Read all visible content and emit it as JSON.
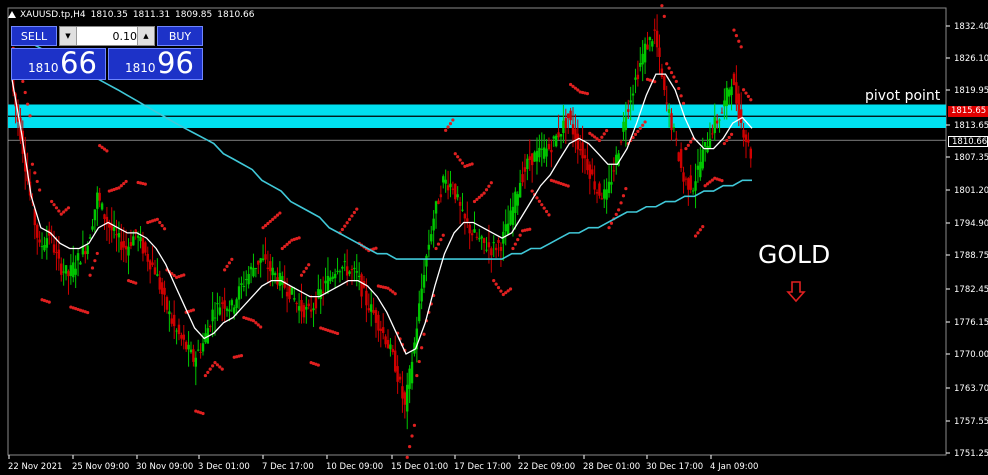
{
  "header": {
    "symbol_info": "XAUUSD.tp,H4",
    "ohlc": [
      "1810.35",
      "1811.31",
      "1809.85",
      "1810.66"
    ],
    "icon": "triangle-up-icon"
  },
  "one_click": {
    "sell_label": "SELL",
    "buy_label": "BUY",
    "lot_value": "0.10",
    "sell_prefix": "1810",
    "sell_pips": "66",
    "buy_prefix": "1810",
    "buy_pips": "96",
    "down_icon": "arrow-down-icon",
    "up_icon": "arrow-up-icon"
  },
  "annotations": {
    "pivot": "pivot point",
    "gold": "GOLD",
    "gold_arrow_icon": "outline-arrow-down-icon",
    "gold_arrow_color": "#e02020"
  },
  "price_tags": {
    "pivot_level": "1815.65",
    "current_bid": "1810.66",
    "pivot_color": "#e00000"
  },
  "colors": {
    "background": "#000000",
    "bull": "#00c800",
    "bear": "#d00000",
    "ma_fast": "#ffffff",
    "ma_slow": "#40c8d8",
    "psar": "#e02020",
    "pivot_band": "#00e0f0"
  },
  "chart_data": {
    "type": "line",
    "instrument": "XAUUSD",
    "timeframe": "H4",
    "y_ticks": [
      "1832.40",
      "1826.10",
      "1819.95",
      "1813.65",
      "1807.35",
      "1801.20",
      "1794.90",
      "1788.75",
      "1782.45",
      "1776.15",
      "1770.00",
      "1763.70",
      "1757.55",
      "1751.25"
    ],
    "x_ticks": [
      "22 Nov 2021",
      "25 Nov 09:00",
      "30 Nov 09:00",
      "3 Dec 01:00",
      "7 Dec 17:00",
      "10 Dec 09:00",
      "15 Dec 01:00",
      "17 Dec 17:00",
      "22 Dec 09:00",
      "28 Dec 01:00",
      "30 Dec 17:00",
      "4 Jan 09:00"
    ],
    "ylim": [
      1749,
      1835
    ],
    "pivot_zone": [
      1813.65,
      1816.8
    ],
    "current_price": 1810.66,
    "series": [
      {
        "kind": "price_path",
        "values": [
          1822,
          1812,
          1800,
          1790,
          1793,
          1787,
          1785,
          1788,
          1791,
          1800,
          1795,
          1792,
          1790,
          1793,
          1789,
          1786,
          1780,
          1775,
          1772,
          1769,
          1772,
          1778,
          1780,
          1779,
          1783,
          1786,
          1788,
          1786,
          1784,
          1782,
          1779,
          1778,
          1781,
          1784,
          1787,
          1786,
          1785,
          1780,
          1777,
          1773,
          1768,
          1760,
          1772,
          1786,
          1796,
          1803,
          1802,
          1796,
          1793,
          1791,
          1790,
          1791,
          1796,
          1803,
          1807,
          1808,
          1809,
          1812,
          1815,
          1810,
          1806,
          1801,
          1800,
          1807,
          1816,
          1822,
          1828,
          1831,
          1819,
          1812,
          1803,
          1802,
          1808,
          1813,
          1816,
          1822,
          1814,
          1808
        ]
      },
      {
        "kind": "moving_average_fast",
        "values": [
          1822,
          1812,
          1800,
          1794,
          1793,
          1791,
          1790,
          1790,
          1791,
          1794,
          1795,
          1794,
          1793,
          1793,
          1792,
          1790,
          1787,
          1783,
          1779,
          1775,
          1773,
          1774,
          1776,
          1777,
          1779,
          1781,
          1783,
          1784,
          1784,
          1783,
          1782,
          1781,
          1781,
          1782,
          1783,
          1784,
          1784,
          1783,
          1781,
          1778,
          1774,
          1770,
          1771,
          1776,
          1783,
          1789,
          1793,
          1795,
          1795,
          1794,
          1793,
          1792,
          1793,
          1796,
          1799,
          1802,
          1804,
          1807,
          1810,
          1811,
          1810,
          1808,
          1806,
          1806,
          1809,
          1814,
          1819,
          1823,
          1823,
          1820,
          1815,
          1811,
          1809,
          1809,
          1811,
          1814,
          1815,
          1813
        ]
      },
      {
        "kind": "moving_average_slow",
        "values": [
          1831,
          1830,
          1829,
          1828,
          1827,
          1826,
          1825,
          1824,
          1823,
          1822,
          1821,
          1820,
          1819,
          1818,
          1817,
          1816,
          1815,
          1814,
          1813,
          1812,
          1811,
          1810,
          1808,
          1807,
          1806,
          1805,
          1803,
          1802,
          1801,
          1799,
          1798,
          1797,
          1796,
          1794,
          1793,
          1792,
          1791,
          1790,
          1789,
          1789,
          1788,
          1788,
          1788,
          1788,
          1788,
          1788,
          1788,
          1788,
          1788,
          1788,
          1788,
          1788,
          1789,
          1789,
          1790,
          1790,
          1791,
          1792,
          1793,
          1793,
          1794,
          1794,
          1795,
          1796,
          1797,
          1797,
          1798,
          1798,
          1799,
          1799,
          1800,
          1800,
          1801,
          1801,
          1802,
          1802,
          1803,
          1803
        ]
      }
    ]
  }
}
